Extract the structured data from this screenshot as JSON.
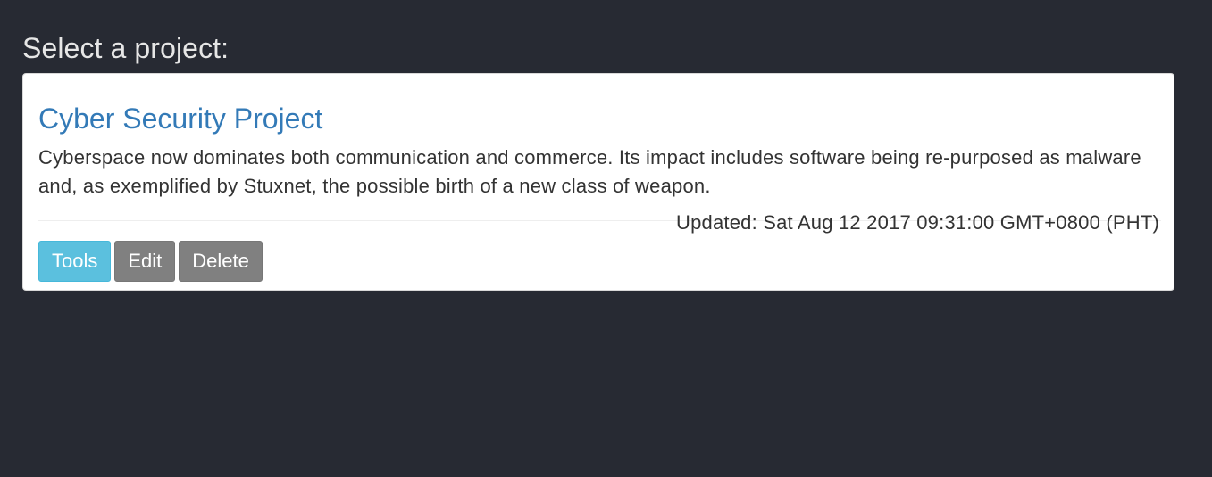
{
  "page": {
    "heading": "Select a project:"
  },
  "project": {
    "title": "Cyber Security Project",
    "description": "Cyberspace now dominates both communication and commerce. Its impact includes software being re-purposed as malware and, as exemplified by Stuxnet, the possible birth of a new class of weapon.",
    "updated": "Updated: Sat Aug 12 2017 09:31:00 GMT+0800 (PHT)",
    "actions": {
      "tools_label": "Tools",
      "edit_label": "Edit",
      "delete_label": "Delete"
    }
  },
  "colors": {
    "background": "#272a33",
    "card": "#ffffff",
    "title_link": "#337ab7",
    "tools_button": "#5bc0de",
    "default_button": "#808080"
  }
}
